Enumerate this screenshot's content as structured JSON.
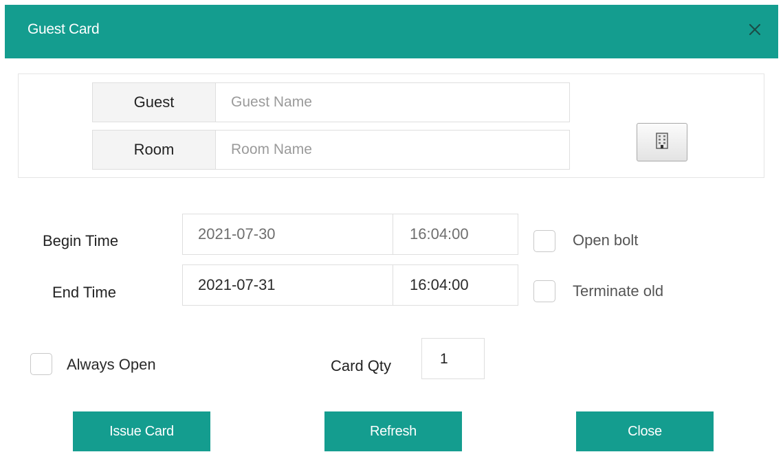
{
  "dialog": {
    "title": "Guest Card",
    "close_icon": "close-icon"
  },
  "guest": {
    "label": "Guest",
    "value": "",
    "placeholder": "Guest Name"
  },
  "room": {
    "label": "Room",
    "value": "",
    "placeholder": "Room Name",
    "picker_icon": "building-icon"
  },
  "begin_time": {
    "label": "Begin Time",
    "date": "2021-07-30",
    "time": "16:04:00"
  },
  "end_time": {
    "label": "End Time",
    "date": "2021-07-31",
    "time": "16:04:00"
  },
  "options": {
    "open_bolt": {
      "label": "Open bolt",
      "checked": false
    },
    "terminate_old": {
      "label": "Terminate old",
      "checked": false
    },
    "always_open": {
      "label": "Always Open",
      "checked": false
    }
  },
  "card_qty": {
    "label": "Card Qty",
    "value": "1"
  },
  "buttons": {
    "issue_card": "Issue Card",
    "refresh": "Refresh",
    "close": "Close"
  },
  "colors": {
    "accent": "#149d8f",
    "title_text": "#ffffff",
    "close_icon": "#1b4d47"
  }
}
